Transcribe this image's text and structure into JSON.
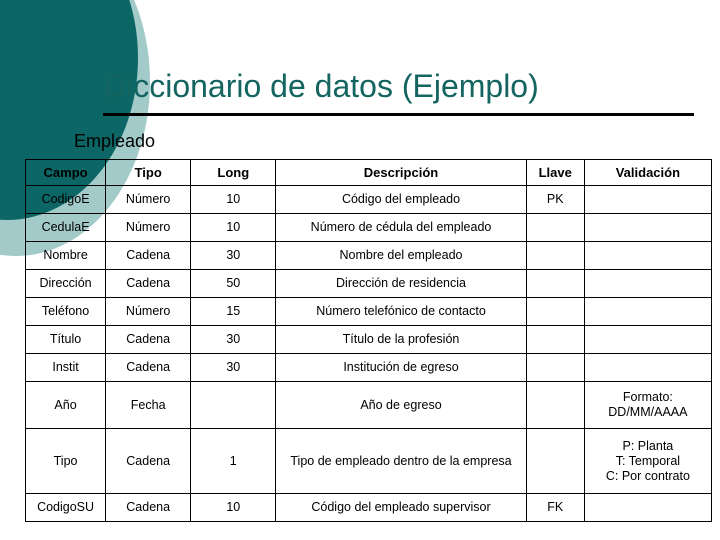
{
  "slide": {
    "title": "Diccionario de datos (Ejemplo)",
    "subtitle": "Empleado",
    "accent_teal_dark": "#0c6665",
    "accent_teal_light": "#a2cac9",
    "title_color": "#146460",
    "pk_color": "#6b6bc8",
    "fk_color": "#b0484c"
  },
  "table": {
    "headers": [
      "Campo",
      "Tipo",
      "Long",
      "Descripción",
      "Llave",
      "Validación"
    ],
    "rows": [
      {
        "campo": "CodigoE",
        "tipo": "Número",
        "long": "10",
        "descripcion": "Código del empleado",
        "llave": "PK",
        "validacion": [
          "",
          "",
          ""
        ],
        "campo_color": "pk",
        "llave_color": "pk"
      },
      {
        "campo": "CedulaE",
        "tipo": "Número",
        "long": "10",
        "descripcion": "Número de cédula del empleado",
        "llave": "",
        "validacion": [
          "",
          "",
          ""
        ],
        "campo_color": "normal",
        "llave_color": "normal"
      },
      {
        "campo": "Nombre",
        "tipo": "Cadena",
        "long": "30",
        "descripcion": "Nombre del empleado",
        "llave": "",
        "validacion": [
          "",
          "",
          ""
        ],
        "campo_color": "normal",
        "llave_color": "normal"
      },
      {
        "campo": "Dirección",
        "tipo": "Cadena",
        "long": "50",
        "descripcion": "Dirección de residencia",
        "llave": "",
        "validacion": [
          "",
          "",
          ""
        ],
        "campo_color": "normal",
        "llave_color": "normal"
      },
      {
        "campo": "Teléfono",
        "tipo": "Número",
        "long": "15",
        "descripcion": "Número telefónico de contacto",
        "llave": "",
        "validacion": [
          "",
          "",
          ""
        ],
        "campo_color": "normal",
        "llave_color": "normal"
      },
      {
        "campo": "Título",
        "tipo": "Cadena",
        "long": "30",
        "descripcion": "Título de la profesión",
        "llave": "",
        "validacion": [
          "",
          "",
          ""
        ],
        "campo_color": "normal",
        "llave_color": "normal"
      },
      {
        "campo": "Instit",
        "tipo": "Cadena",
        "long": "30",
        "descripcion": "Institución de egreso",
        "llave": "",
        "validacion": [
          "",
          "",
          ""
        ],
        "campo_color": "normal",
        "llave_color": "normal"
      },
      {
        "campo": "Año",
        "tipo": "Fecha",
        "long": "",
        "descripcion": "Año de egreso",
        "llave": "",
        "validacion": [
          "Formato:",
          "DD/MM/AAAA",
          ""
        ],
        "campo_color": "normal",
        "llave_color": "normal"
      },
      {
        "campo": "Tipo",
        "tipo": "Cadena",
        "long": "1",
        "descripcion": "Tipo de empleado dentro de la empresa",
        "llave": "",
        "validacion": [
          "P: Planta",
          "T: Temporal",
          "C: Por contrato"
        ],
        "campo_color": "normal",
        "llave_color": "normal"
      },
      {
        "campo": "CodigoSU",
        "tipo": "Cadena",
        "long": "10",
        "descripcion": "Código del empleado supervisor",
        "llave": "FK",
        "validacion": [
          "",
          "",
          ""
        ],
        "campo_color": "fk",
        "llave_color": "fk"
      }
    ]
  }
}
